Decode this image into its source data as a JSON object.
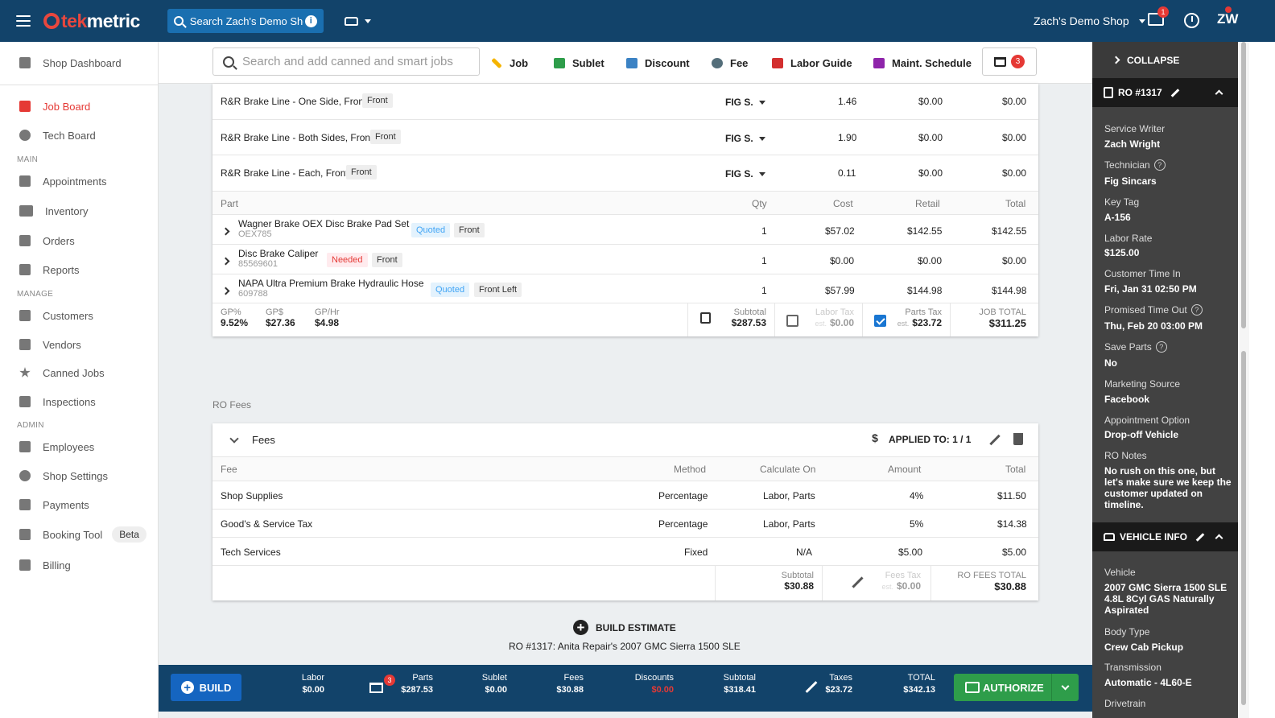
{
  "topbar": {
    "logo_part1": "tek",
    "logo_part2": "metric",
    "search_placeholder": "Search Zach's Demo Shop",
    "shop_name": "Zach's Demo Shop",
    "messages_badge": "1",
    "user_initials": "ZW",
    "brand_color": "#12436a",
    "accent_color": "#e8473e"
  },
  "sidebar": {
    "dashboard": "Shop Dashboard",
    "job_board": "Job Board",
    "tech_board": "Tech Board",
    "section_main": "MAIN",
    "appointments": "Appointments",
    "inventory": "Inventory",
    "orders": "Orders",
    "reports": "Reports",
    "section_manage": "MANAGE",
    "customers": "Customers",
    "vendors": "Vendors",
    "canned_jobs": "Canned Jobs",
    "inspections": "Inspections",
    "section_admin": "ADMIN",
    "employees": "Employees",
    "shop_settings": "Shop Settings",
    "payments": "Payments",
    "booking_tool": "Booking Tool",
    "beta": "Beta",
    "billing": "Billing"
  },
  "toolbar": {
    "search_placeholder": "Search and add canned and smart jobs",
    "job": "Job",
    "sublet": "Sublet",
    "discount": "Discount",
    "fee": "Fee",
    "labor_guide": "Labor Guide",
    "maint_schedule": "Maint. Schedule",
    "cart_count": "3"
  },
  "labor_rows": [
    {
      "name": "R&R Brake Line - One Side, Front",
      "tag": "Front",
      "tech": "FIG S.",
      "hours": "1.46",
      "rate": "$0.00",
      "total": "$0.00"
    },
    {
      "name": "R&R Brake Line - Both Sides, Front",
      "tag": "Front",
      "tech": "FIG S.",
      "hours": "1.90",
      "rate": "$0.00",
      "total": "$0.00"
    },
    {
      "name": "R&R Brake Line - Each, Front",
      "tag": "Front",
      "tech": "FIG S.",
      "hours": "0.11",
      "rate": "$0.00",
      "total": "$0.00"
    }
  ],
  "parts_header": {
    "part": "Part",
    "qty": "Qty",
    "cost": "Cost",
    "retail": "Retail",
    "total": "Total"
  },
  "parts": [
    {
      "name": "Wagner Brake OEX Disc Brake Pad Set",
      "number": "OEX785",
      "status": "Quoted",
      "position": "Front",
      "qty": "1",
      "cost": "$57.02",
      "retail": "$142.55",
      "total": "$142.55"
    },
    {
      "name": "Disc Brake Caliper",
      "number": "85569601",
      "status": "Needed",
      "position": "Front",
      "qty": "1",
      "cost": "$0.00",
      "retail": "$0.00",
      "total": "$0.00"
    },
    {
      "name": "NAPA Ultra Premium Brake Hydraulic Hose",
      "number": "609788",
      "status": "Quoted",
      "position": "Front Left",
      "qty": "1",
      "cost": "$57.99",
      "retail": "$144.98",
      "total": "$144.98"
    }
  ],
  "job_summary": {
    "gp_pct_label": "GP%",
    "gp_pct": "9.52%",
    "gp_dollar_label": "GP$",
    "gp_dollar": "$27.36",
    "gp_hr_label": "GP/Hr",
    "gp_hr": "$4.98",
    "subtotal_label": "Subtotal",
    "subtotal": "$287.53",
    "labor_tax_label": "Labor Tax",
    "labor_tax_est": "est.",
    "labor_tax": "$0.00",
    "parts_tax_label": "Parts Tax",
    "parts_tax_est": "est.",
    "parts_tax": "$23.72",
    "job_total_label": "JOB TOTAL",
    "job_total": "$311.25"
  },
  "ro_fees": {
    "section_label": "RO Fees",
    "title": "Fees",
    "applied_to": "APPLIED TO: 1 / 1",
    "header": {
      "fee": "Fee",
      "method": "Method",
      "calc": "Calculate On",
      "amount": "Amount",
      "total": "Total"
    },
    "rows": [
      {
        "fee": "Shop Supplies",
        "method": "Percentage",
        "calc": "Labor, Parts",
        "amount": "4%",
        "total": "$11.50"
      },
      {
        "fee": "Good's & Service Tax",
        "method": "Percentage",
        "calc": "Labor, Parts",
        "amount": "5%",
        "total": "$14.38"
      },
      {
        "fee": "Tech Services",
        "method": "Fixed",
        "calc": "N/A",
        "amount": "$5.00",
        "total": "$5.00"
      }
    ],
    "subtotal_label": "Subtotal",
    "subtotal": "$30.88",
    "fees_tax_label": "Fees Tax",
    "fees_tax_est": "est.",
    "fees_tax": "$0.00",
    "total_label": "RO FEES TOTAL",
    "total": "$30.88"
  },
  "build_estimate": {
    "label": "BUILD ESTIMATE",
    "caption": "RO #1317: Anita Repair's 2007 GMC Sierra 1500 SLE"
  },
  "bottombar": {
    "build": "BUILD",
    "labor_label": "Labor",
    "labor": "$0.00",
    "parts_badge": "3",
    "parts_label": "Parts",
    "parts": "$287.53",
    "sublet_label": "Sublet",
    "sublet": "$0.00",
    "fees_label": "Fees",
    "fees": "$30.88",
    "discounts_label": "Discounts",
    "discounts": "$0.00",
    "subtotal_label": "Subtotal",
    "subtotal": "$318.41",
    "taxes_label": "Taxes",
    "taxes": "$23.72",
    "total_label": "TOTAL",
    "total": "$342.13",
    "authorize": "AUTHORIZE"
  },
  "rightpanel": {
    "collapse": "COLLAPSE",
    "ro_title": "RO #1317",
    "service_writer_label": "Service Writer",
    "service_writer": "Zach Wright",
    "technician_label": "Technician",
    "technician": "Fig Sincars",
    "key_tag_label": "Key Tag",
    "key_tag": "A-156",
    "labor_rate_label": "Labor Rate",
    "labor_rate": "$125.00",
    "time_in_label": "Customer Time In",
    "time_in": "Fri, Jan 31 02:50 PM",
    "time_out_label": "Promised Time Out",
    "time_out": "Thu, Feb 20 03:00 PM",
    "save_parts_label": "Save Parts",
    "save_parts": "No",
    "marketing_label": "Marketing Source",
    "marketing": "Facebook",
    "appt_label": "Appointment Option",
    "appt": "Drop-off Vehicle",
    "notes_label": "RO Notes",
    "notes": "No rush on this one, but let's make sure we keep the customer updated on timeline.",
    "vehicle_title": "VEHICLE INFO",
    "vehicle_label": "Vehicle",
    "vehicle": "2007 GMC Sierra 1500 SLE 4.8L 8Cyl GAS Naturally Aspirated",
    "body_label": "Body Type",
    "body": "Crew Cab Pickup",
    "trans_label": "Transmission",
    "trans": "Automatic - 4L60-E",
    "drivetrain_label": "Drivetrain"
  }
}
